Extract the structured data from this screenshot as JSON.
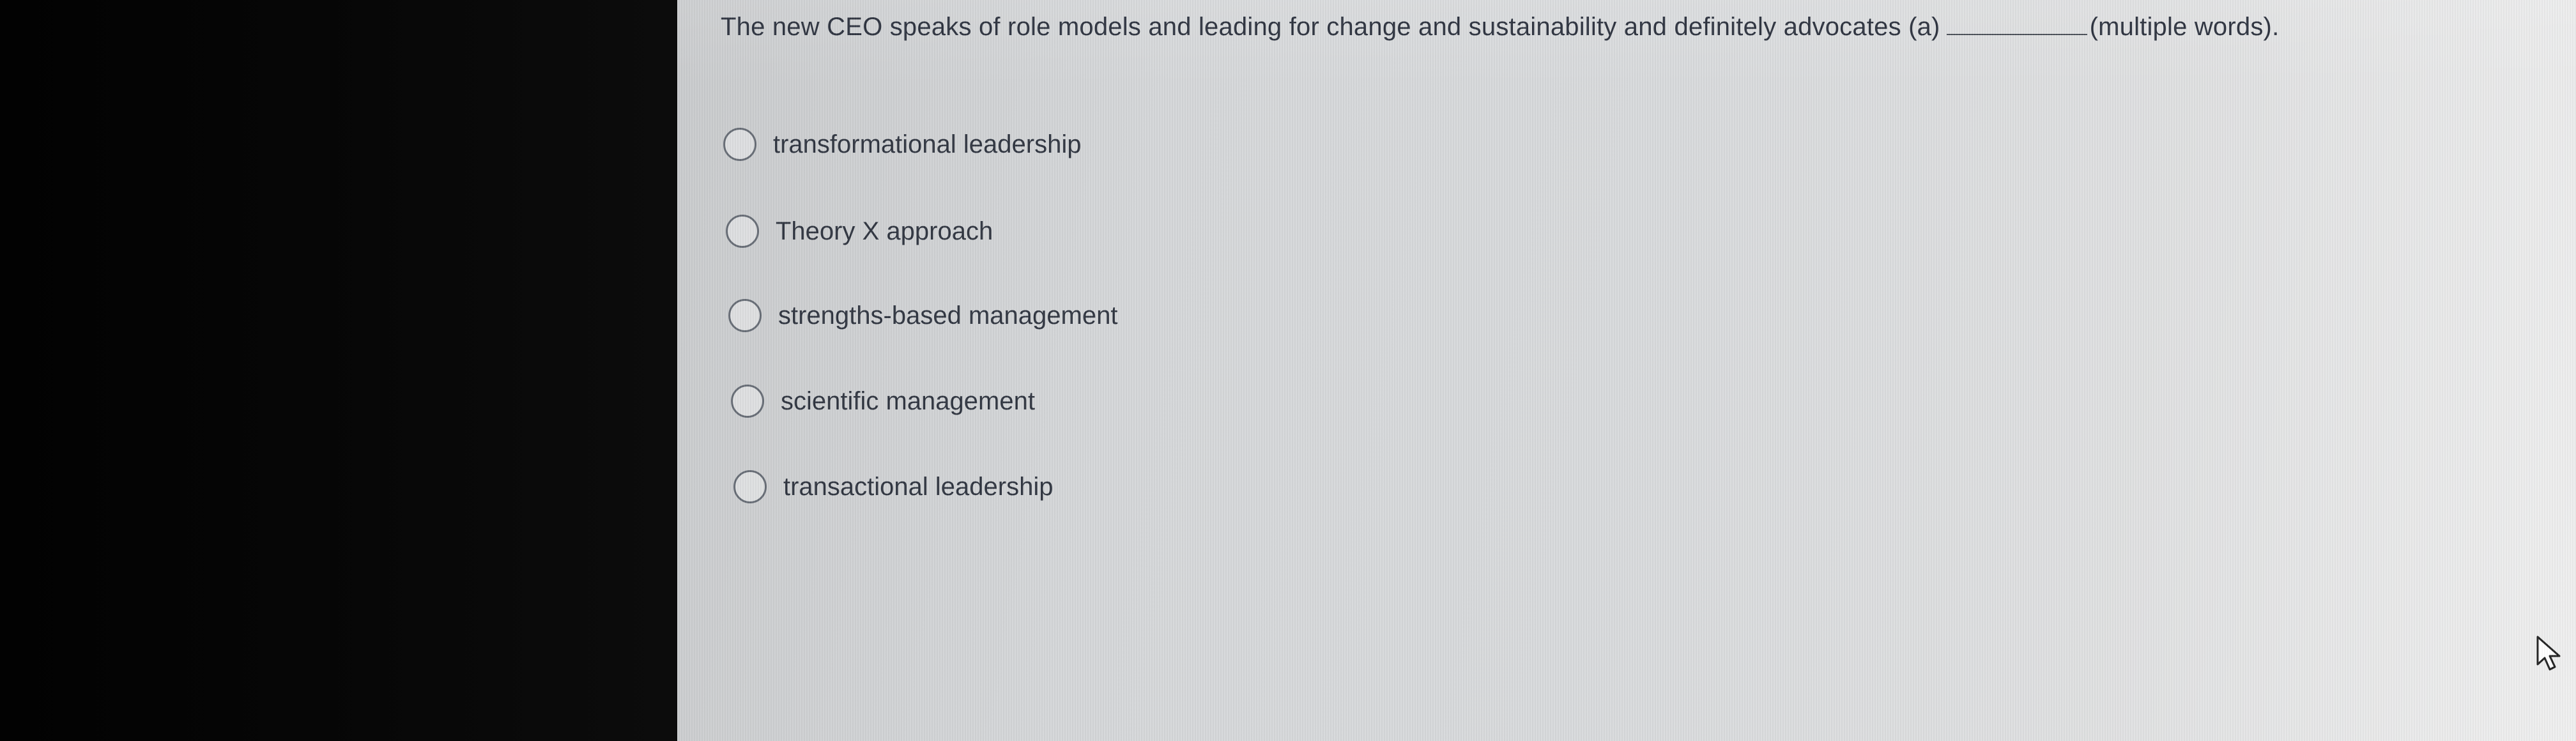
{
  "question": {
    "prefix": "The new CEO speaks of role models and leading for change and sustainability and definitely advocates (a)",
    "suffix": "(multiple words)."
  },
  "options": [
    {
      "label": "transformational leadership",
      "selected": false
    },
    {
      "label": "Theory X approach",
      "selected": false
    },
    {
      "label": "strengths-based management",
      "selected": false
    },
    {
      "label": "scientific management",
      "selected": false
    },
    {
      "label": "transactional leadership",
      "selected": false
    }
  ],
  "icons": {
    "radio": "radio-unselected-icon",
    "cursor": "mouse-pointer-icon"
  }
}
